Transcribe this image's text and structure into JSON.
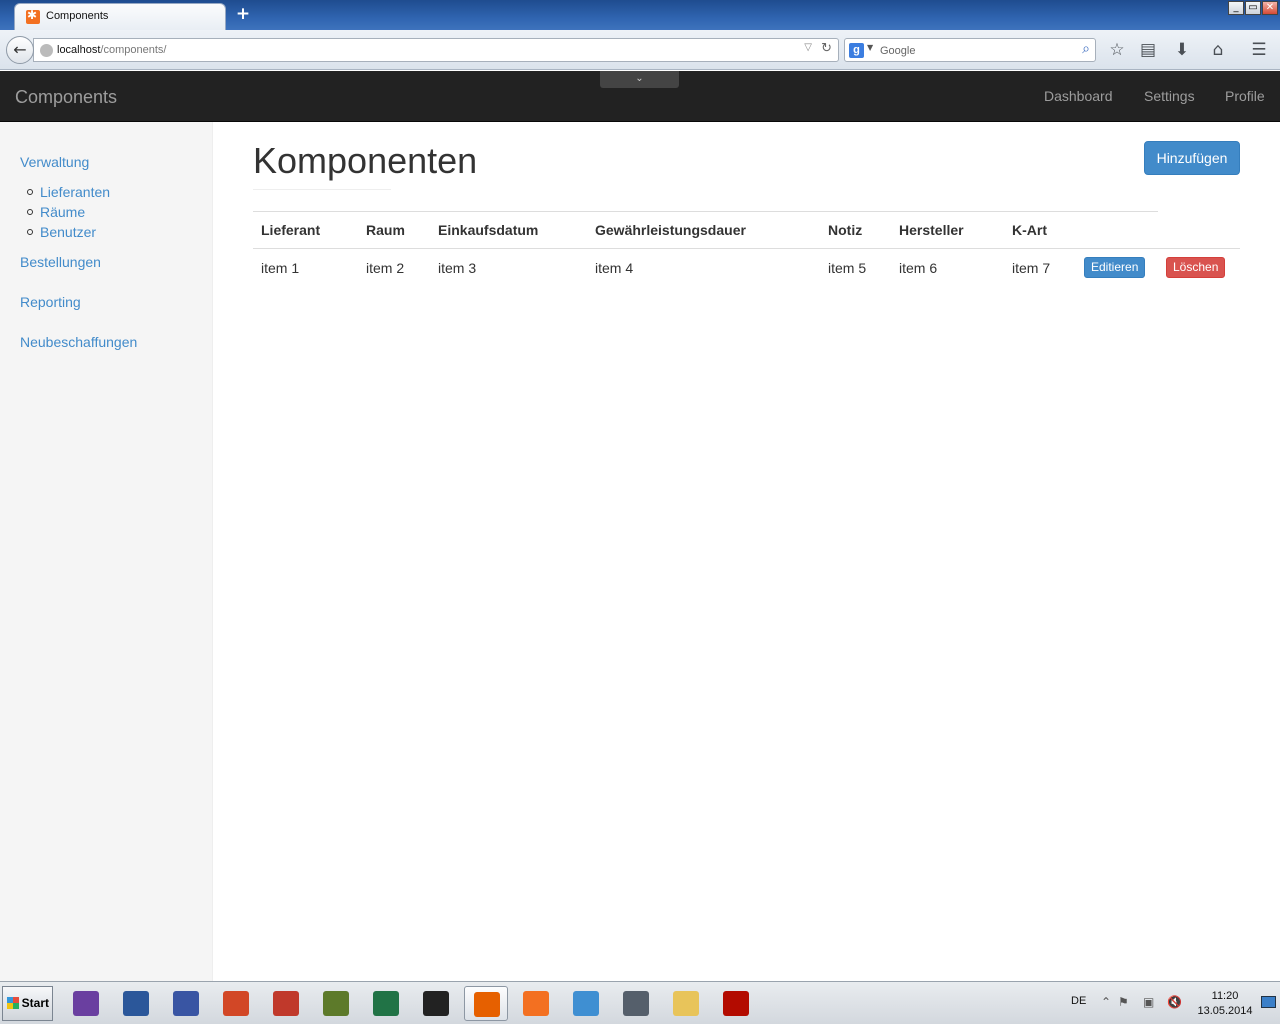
{
  "browser": {
    "tab_title": "Components",
    "url_host": "localhost",
    "url_path": "/components/",
    "search_placeholder": "Google",
    "window_controls": [
      "_",
      "▭",
      "✕"
    ]
  },
  "app": {
    "brand": "Components",
    "nav_links": [
      "Dashboard",
      "Settings",
      "Profile"
    ]
  },
  "sidebar": {
    "sections": [
      {
        "label": "Verwaltung",
        "children": [
          "Lieferanten",
          "Räume",
          "Benutzer"
        ]
      },
      {
        "label": "Bestellungen"
      },
      {
        "label": "Reporting"
      },
      {
        "label": "Neubeschaffungen"
      }
    ]
  },
  "main": {
    "title": "Komponenten",
    "add_button": "Hinzufügen",
    "table": {
      "headers": [
        "Lieferant",
        "Raum",
        "Einkaufsdatum",
        "Gewährleistungsdauer",
        "Notiz",
        "Hersteller",
        "K-Art"
      ],
      "rows": [
        {
          "cells": [
            "item 1",
            "item 2",
            "item 3",
            "item 4",
            "item 5",
            "item 6",
            "item 7"
          ],
          "edit_label": "Editieren",
          "delete_label": "Löschen"
        }
      ]
    }
  },
  "taskbar": {
    "start_label": "Start",
    "language": "DE",
    "time": "11:20",
    "date": "13.05.2014",
    "apps": [
      {
        "name": "visual-studio-icon",
        "color": "#6a3fa0"
      },
      {
        "name": "word-icon",
        "color": "#2b579a"
      },
      {
        "name": "visio-icon",
        "color": "#3955a3"
      },
      {
        "name": "powerpoint-icon",
        "color": "#d24726"
      },
      {
        "name": "red-app-icon",
        "color": "#c0392b"
      },
      {
        "name": "tortoise-icon",
        "color": "#5d7a2a"
      },
      {
        "name": "excel-icon",
        "color": "#217346"
      },
      {
        "name": "inkscape-icon",
        "color": "#222222"
      },
      {
        "name": "firefox-icon",
        "color": "#e66000"
      },
      {
        "name": "xampp-icon",
        "color": "#f37021"
      },
      {
        "name": "blue-app-icon",
        "color": "#3f8fd2"
      },
      {
        "name": "ubuntu-one-icon",
        "color": "#555f6b"
      },
      {
        "name": "explorer-icon",
        "color": "#e8c45a"
      },
      {
        "name": "acrobat-icon",
        "color": "#b30b00"
      }
    ]
  }
}
